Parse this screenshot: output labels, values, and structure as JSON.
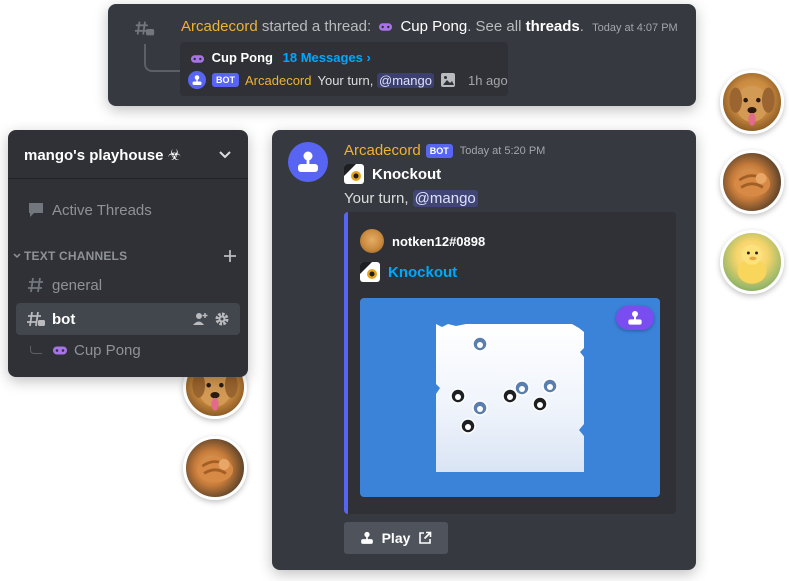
{
  "thread_card": {
    "author": "Arcadecord",
    "action_text": "started a thread:",
    "thread_name": "Cup Pong",
    "see_all": "See all",
    "threads_link": "threads",
    "period": ".",
    "timestamp": "Today at 4:07 PM",
    "preview": {
      "name": "Cup Pong",
      "message_count": "18 Messages ›",
      "bot_tag": "BOT",
      "author": "Arcadecord",
      "text": "Your turn,",
      "mention": "@mango",
      "ago": "1h ago"
    }
  },
  "server": {
    "name": "mango's playhouse ☣",
    "active_threads": "Active Threads",
    "category": "TEXT CHANNELS",
    "channels": [
      {
        "name": "general"
      },
      {
        "name": "bot"
      }
    ],
    "thread": "Cup Pong"
  },
  "message": {
    "author": "Arcadecord",
    "bot_tag": "BOT",
    "timestamp": "Today at 5:20 PM",
    "game_title": "Knockout",
    "text": "Your turn,",
    "mention": "@mango",
    "embed": {
      "author": "notken12#0898",
      "title": "Knockout"
    },
    "play_button": "Play"
  },
  "colors": {
    "bot_name": "#f0b232",
    "blurple": "#5865f2",
    "link": "#00a8fc",
    "embed_image_bg": "#3b82d9"
  }
}
